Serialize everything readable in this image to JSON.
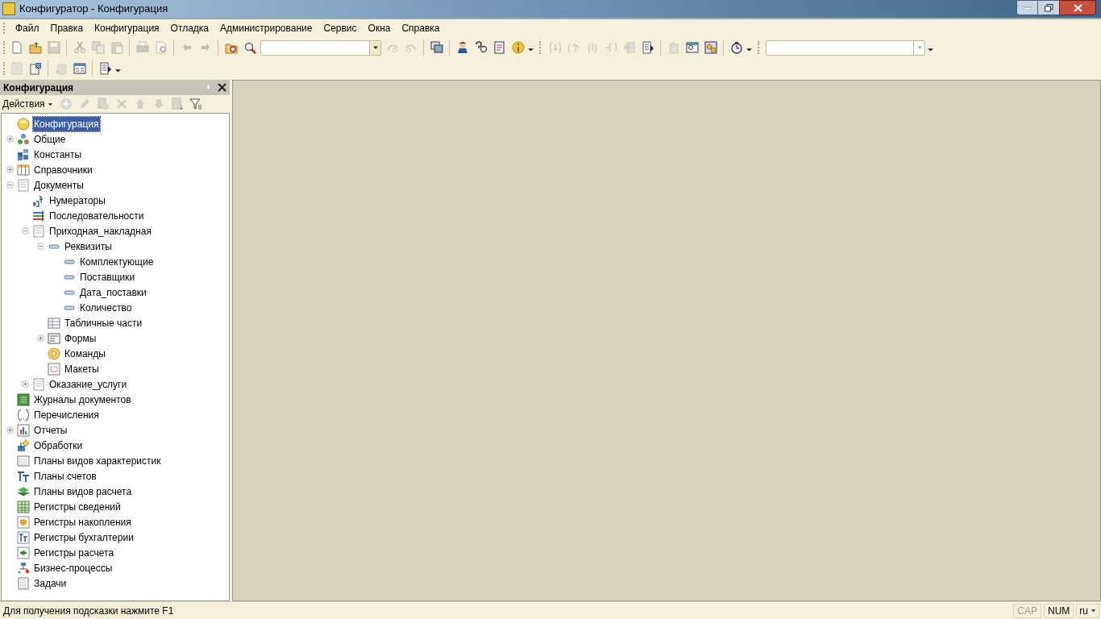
{
  "window": {
    "title": "Конфигуратор - Конфигурация"
  },
  "menu": [
    {
      "label": "Файл"
    },
    {
      "label": "Правка"
    },
    {
      "label": "Конфигурация"
    },
    {
      "label": "Отладка"
    },
    {
      "label": "Администрирование"
    },
    {
      "label": "Сервис"
    },
    {
      "label": "Окна"
    },
    {
      "label": "Справка"
    }
  ],
  "toolbar_1": [
    {
      "kind": "new",
      "disabled": false
    },
    {
      "kind": "open",
      "disabled": false
    },
    {
      "kind": "save",
      "disabled": true
    },
    {
      "kind": "sep"
    },
    {
      "kind": "cut",
      "disabled": true
    },
    {
      "kind": "copy",
      "disabled": true
    },
    {
      "kind": "paste",
      "disabled": true
    },
    {
      "kind": "sep"
    },
    {
      "kind": "print",
      "disabled": true
    },
    {
      "kind": "preview",
      "disabled": true
    },
    {
      "kind": "sep"
    },
    {
      "kind": "undo",
      "disabled": true
    },
    {
      "kind": "redo",
      "disabled": true
    },
    {
      "kind": "sep"
    },
    {
      "kind": "find-folder",
      "disabled": false
    },
    {
      "kind": "search",
      "disabled": false
    },
    {
      "kind": "combo"
    },
    {
      "kind": "find-next",
      "disabled": true
    },
    {
      "kind": "find-prev",
      "disabled": true
    },
    {
      "kind": "sep"
    },
    {
      "kind": "windows",
      "disabled": false
    },
    {
      "kind": "sep"
    },
    {
      "kind": "help",
      "disabled": false
    },
    {
      "kind": "help-search",
      "disabled": false
    },
    {
      "kind": "book",
      "disabled": false
    },
    {
      "kind": "info",
      "disabled": false
    },
    {
      "kind": "dropdown"
    },
    {
      "kind": "grip"
    },
    {
      "kind": "step-in",
      "disabled": true
    },
    {
      "kind": "step-over",
      "disabled": true
    },
    {
      "kind": "step-out",
      "disabled": true
    },
    {
      "kind": "run-to",
      "disabled": true
    },
    {
      "kind": "arrow-doc",
      "disabled": true
    },
    {
      "kind": "doc-run",
      "disabled": false
    },
    {
      "kind": "sep"
    },
    {
      "kind": "doc-user",
      "disabled": true
    },
    {
      "kind": "window-search",
      "disabled": false
    },
    {
      "kind": "gears",
      "disabled": false
    },
    {
      "kind": "sep"
    },
    {
      "kind": "stopwatch",
      "disabled": false
    },
    {
      "kind": "dropdown"
    },
    {
      "kind": "grip"
    },
    {
      "kind": "combo-wide"
    },
    {
      "kind": "dropdown"
    }
  ],
  "toolbar_2": [
    {
      "kind": "doc-tree",
      "disabled": true
    },
    {
      "kind": "doc-x",
      "disabled": false
    },
    {
      "kind": "sep"
    },
    {
      "kind": "database",
      "disabled": true
    },
    {
      "kind": "form",
      "disabled": false
    },
    {
      "kind": "sep"
    },
    {
      "kind": "doc-run",
      "disabled": false
    },
    {
      "kind": "dropdown"
    }
  ],
  "panel": {
    "title": "Конфигурация",
    "actions_label": "Действия",
    "actions": [
      {
        "kind": "add",
        "disabled": true
      },
      {
        "kind": "edit",
        "disabled": true
      },
      {
        "kind": "copy-add",
        "disabled": true
      },
      {
        "kind": "delete",
        "disabled": true
      },
      {
        "kind": "up",
        "disabled": true
      },
      {
        "kind": "down",
        "disabled": true
      },
      {
        "kind": "sort",
        "disabled": true
      },
      {
        "kind": "filter",
        "disabled": false
      }
    ],
    "tree": [
      {
        "label": "Конфигурация",
        "kind": "config",
        "selected": true
      },
      {
        "label": "Общие",
        "kind": "common",
        "selected": false,
        "expanded": false
      },
      {
        "label": "Константы",
        "kind": "constants",
        "selected": false
      },
      {
        "label": "Справочники",
        "kind": "catalog",
        "selected": false,
        "expanded": false
      },
      {
        "label": "Документы",
        "kind": "doc",
        "selected": false,
        "expanded": true,
        "children": [
          {
            "label": "Нумераторы",
            "kind": "numbers",
            "selected": false
          },
          {
            "label": "Последовательности",
            "kind": "sequence",
            "selected": false
          },
          {
            "label": "Приходная_накладная",
            "kind": "doc",
            "selected": false,
            "expanded": true,
            "children": [
              {
                "label": "Реквизиты",
                "kind": "attr",
                "selected": false,
                "expanded": true,
                "children": [
                  {
                    "label": "Комплектующие",
                    "kind": "attr",
                    "selected": false
                  },
                  {
                    "label": "Поставщики",
                    "kind": "attr",
                    "selected": false
                  },
                  {
                    "label": "Дата_поставки",
                    "kind": "attr",
                    "selected": false
                  },
                  {
                    "label": "Количество",
                    "kind": "attr",
                    "selected": false
                  }
                ]
              },
              {
                "label": "Табличные части",
                "kind": "table",
                "selected": false
              },
              {
                "label": "Формы",
                "kind": "form",
                "selected": false,
                "expanded": false
              },
              {
                "label": "Команды",
                "kind": "command",
                "selected": false
              },
              {
                "label": "Макеты",
                "kind": "template",
                "selected": false
              }
            ]
          },
          {
            "label": "Оказание_услуги",
            "kind": "doc",
            "selected": false,
            "expanded": false
          }
        ]
      },
      {
        "label": "Журналы документов",
        "kind": "journal",
        "selected": false
      },
      {
        "label": "Перечисления",
        "kind": "enum",
        "selected": false
      },
      {
        "label": "Отчеты",
        "kind": "report",
        "selected": false,
        "expanded": false
      },
      {
        "label": "Обработки",
        "kind": "processing",
        "selected": false
      },
      {
        "label": "Планы видов характеристик",
        "kind": "char",
        "selected": false
      },
      {
        "label": "Планы счетов",
        "kind": "accounts",
        "selected": false
      },
      {
        "label": "Планы видов расчета",
        "kind": "calc",
        "selected": false
      },
      {
        "label": "Регистры сведений",
        "kind": "inforeg",
        "selected": false
      },
      {
        "label": "Регистры накопления",
        "kind": "accumreg",
        "selected": false
      },
      {
        "label": "Регистры бухгалтерии",
        "kind": "accreg",
        "selected": false
      },
      {
        "label": "Регистры расчета",
        "kind": "calcreg",
        "selected": false
      },
      {
        "label": "Бизнес-процессы",
        "kind": "bp",
        "selected": false
      },
      {
        "label": "Задачи",
        "kind": "task",
        "selected": false
      }
    ]
  },
  "status_bar": {
    "hint": "Для получения подсказки нажмите F1",
    "indicators": [
      {
        "label": "CAP",
        "on": false
      },
      {
        "label": "NUM",
        "on": true
      }
    ],
    "language": "ru"
  }
}
